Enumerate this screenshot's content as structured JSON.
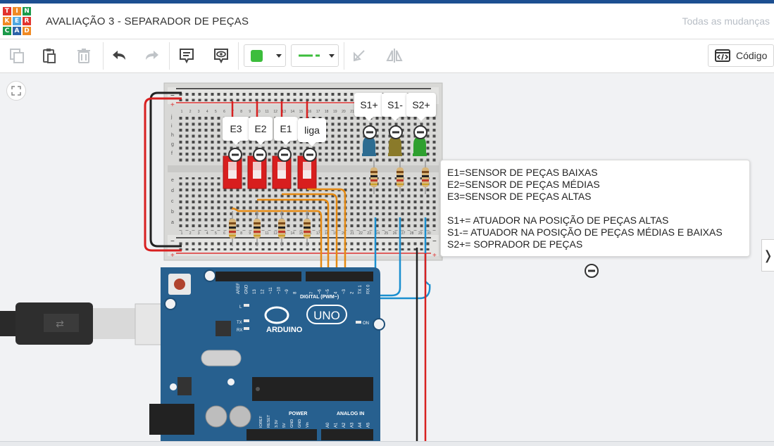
{
  "app": {
    "logo_letters": [
      "T",
      "I",
      "N",
      "K",
      "E",
      "R",
      "C",
      "A",
      "D"
    ],
    "logo_colors": [
      "#e2332d",
      "#f08a24",
      "#1b9a4a",
      "#f08a24",
      "#4fa8e0",
      "#e2332d",
      "#1b9a4a",
      "#2d63a8",
      "#f08a24"
    ],
    "project_title": "AVALIAÇÃO 3 - SEPARADOR DE PEÇAS",
    "save_status": "Todas as mudanças"
  },
  "toolbar": {
    "tools": [
      "copy-icon",
      "paste-icon",
      "trash-icon",
      "undo-icon",
      "redo-icon",
      "note-icon",
      "eye-icon",
      "flip-icon",
      "mirror-icon"
    ],
    "color_value": "#3cbd3c",
    "wire_color": "#3cbd3c",
    "code_label": "Código"
  },
  "circuit": {
    "switch_labels": [
      "E3",
      "E2",
      "E1",
      "liga"
    ],
    "led_labels": [
      "S1+",
      "S1-",
      "S2+"
    ],
    "led_colors": [
      "#2d6c91",
      "#8a7a2a",
      "#2fa02f"
    ],
    "breadboard_numbers": [
      "1",
      "2",
      "3",
      "4",
      "5",
      "6",
      "7",
      "8",
      "9",
      "10",
      "11",
      "12",
      "13",
      "14",
      "15",
      "16",
      "17",
      "18",
      "19",
      "20",
      "21",
      "22",
      "23",
      "24",
      "25",
      "26",
      "27",
      "28",
      "29",
      "30"
    ],
    "breadboard_rows": [
      "j",
      "i",
      "h",
      "g",
      "f",
      "e",
      "d",
      "c",
      "b",
      "a"
    ],
    "rail_sign_minus": "−",
    "rail_sign_plus": "+",
    "arduino": {
      "brand": "ARDUINO",
      "model": "UNO",
      "digital_label": "DIGITAL (PWM~)",
      "pins_top": [
        "AREF",
        "GND",
        "13",
        "12",
        "~11",
        "~10",
        "~9",
        "8",
        "7",
        "~6",
        "~5",
        "4",
        "~3",
        "2",
        "TX 1",
        "RX 0"
      ],
      "led_labels": [
        "L",
        "TX",
        "RX"
      ],
      "on_label": "ON",
      "power_label": "POWER",
      "analog_label": "ANALOG IN",
      "power_pins": [
        "IOREF",
        "RESET",
        "3.3V",
        "5V",
        "GND",
        "GND",
        "Vin"
      ],
      "analog_pins": [
        "A0",
        "A1",
        "A2",
        "A3",
        "A4",
        "A5"
      ]
    }
  },
  "note": {
    "lines": [
      "E1=SENSOR DE PEÇAS BAIXAS",
      "E2=SENSOR DE PEÇAS MÉDIAS",
      "E3=SENSOR DE PEÇAS ALTAS",
      "",
      "S1+= ATUADOR NA POSIÇÃO DE PEÇAS ALTAS",
      "S1-= ATUADOR NA POSIÇÃO DE PEÇAS MÉDIAS E BAIXAS",
      "S2+= SOPRADOR DE PEÇAS"
    ]
  },
  "side_toggle_label": "❭"
}
